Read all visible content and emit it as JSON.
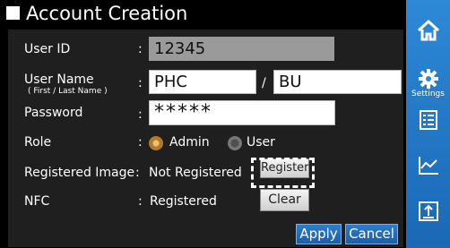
{
  "title": "Account Creation",
  "form": {
    "user_id_label": "User ID",
    "user_id_value": "12345",
    "user_name_label": "User Name",
    "user_name_hint": "( First / Last Name )",
    "first_name": "PHC",
    "last_name": "BU",
    "name_separator": "/",
    "password_label": "Password",
    "password_value": "*****",
    "role_label": "Role",
    "role_options": [
      "Admin",
      "User"
    ],
    "role_selected": "Admin",
    "registered_image_label": "Registered Image",
    "registered_image_status": "Not Registered",
    "register_button": "Register",
    "nfc_label": "NFC",
    "nfc_status": "Registered",
    "clear_button": "Clear",
    "colon": ":"
  },
  "footer": {
    "apply": "Apply",
    "cancel": "Cancel"
  },
  "sidebar": {
    "items": [
      {
        "name": "home-icon",
        "label": ""
      },
      {
        "name": "settings-icon",
        "label": "Settings"
      },
      {
        "name": "list-icon",
        "label": ""
      },
      {
        "name": "chart-icon",
        "label": ""
      },
      {
        "name": "export-icon",
        "label": ""
      }
    ]
  },
  "colors": {
    "sidebar": "#2d89d6",
    "panel": "#1f1f1f",
    "button_blue": "#1b5ea8",
    "field_disabled": "#9a9a9a"
  }
}
